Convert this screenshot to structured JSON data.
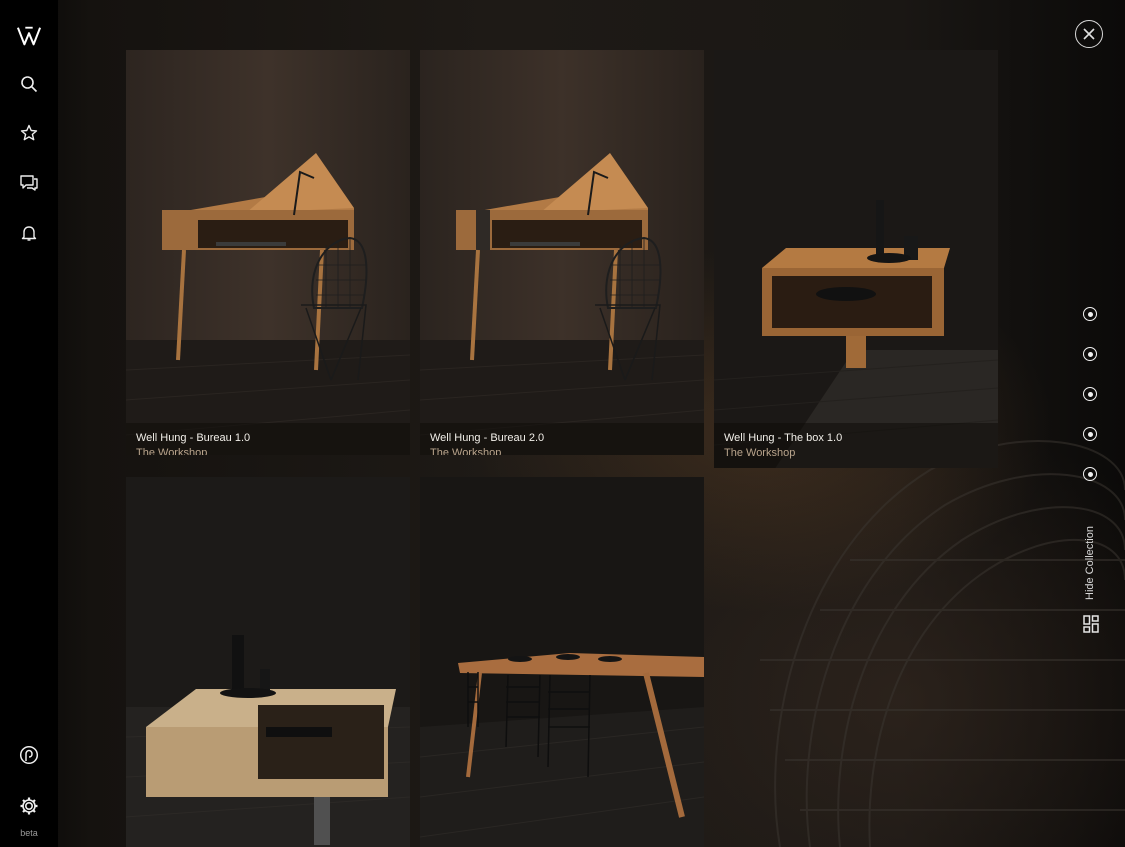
{
  "app": {
    "logo": "W",
    "beta_label": "beta"
  },
  "sidebar": {
    "items": [
      {
        "name": "search-icon"
      },
      {
        "name": "star-icon"
      },
      {
        "name": "chat-icon"
      },
      {
        "name": "bell-icon"
      }
    ],
    "bottom": [
      {
        "name": "profile-icon"
      },
      {
        "name": "settings-icon"
      }
    ]
  },
  "collection": {
    "items": [
      {
        "title": "Well Hung - Bureau 1.0",
        "maker": "The Workshop"
      },
      {
        "title": "Well Hung - Bureau 2.0",
        "maker": "The Workshop"
      },
      {
        "title": "Well Hung - The box 1.0",
        "maker": "The Workshop"
      }
    ]
  },
  "right_panel": {
    "hide_label": "Hide Collection",
    "pagination_count": 5,
    "active_dot": 0
  },
  "colors": {
    "accent": "#f2efe9",
    "subtitle": "#b9a48c",
    "background": "#0d0b09"
  }
}
